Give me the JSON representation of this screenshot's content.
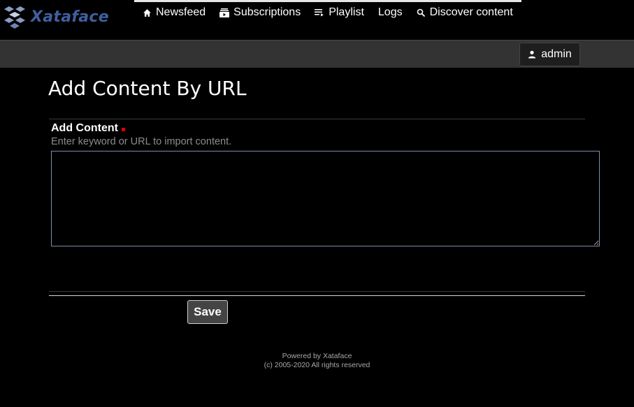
{
  "brand": {
    "name": "Xataface",
    "color": "#3f5fa0"
  },
  "nav": {
    "items": [
      {
        "label": "Newsfeed",
        "icon": "home-icon"
      },
      {
        "label": "Subscriptions",
        "icon": "subscriptions-icon"
      },
      {
        "label": "Playlist",
        "icon": "playlist-icon"
      },
      {
        "label": "Logs",
        "icon": ""
      },
      {
        "label": "Discover content",
        "icon": "search-icon"
      }
    ]
  },
  "user": {
    "label": "admin",
    "icon": "person-icon"
  },
  "page": {
    "title": "Add Content By URL"
  },
  "form": {
    "field": {
      "label": "Add Content",
      "help": "Enter keyword or URL to import content.",
      "value": "",
      "required": true,
      "required_color": "#e00000"
    },
    "save_label": "Save"
  },
  "footer": {
    "line1": "Powered by Xataface",
    "line2": "(c) 2005-2020 All rights reserved"
  }
}
